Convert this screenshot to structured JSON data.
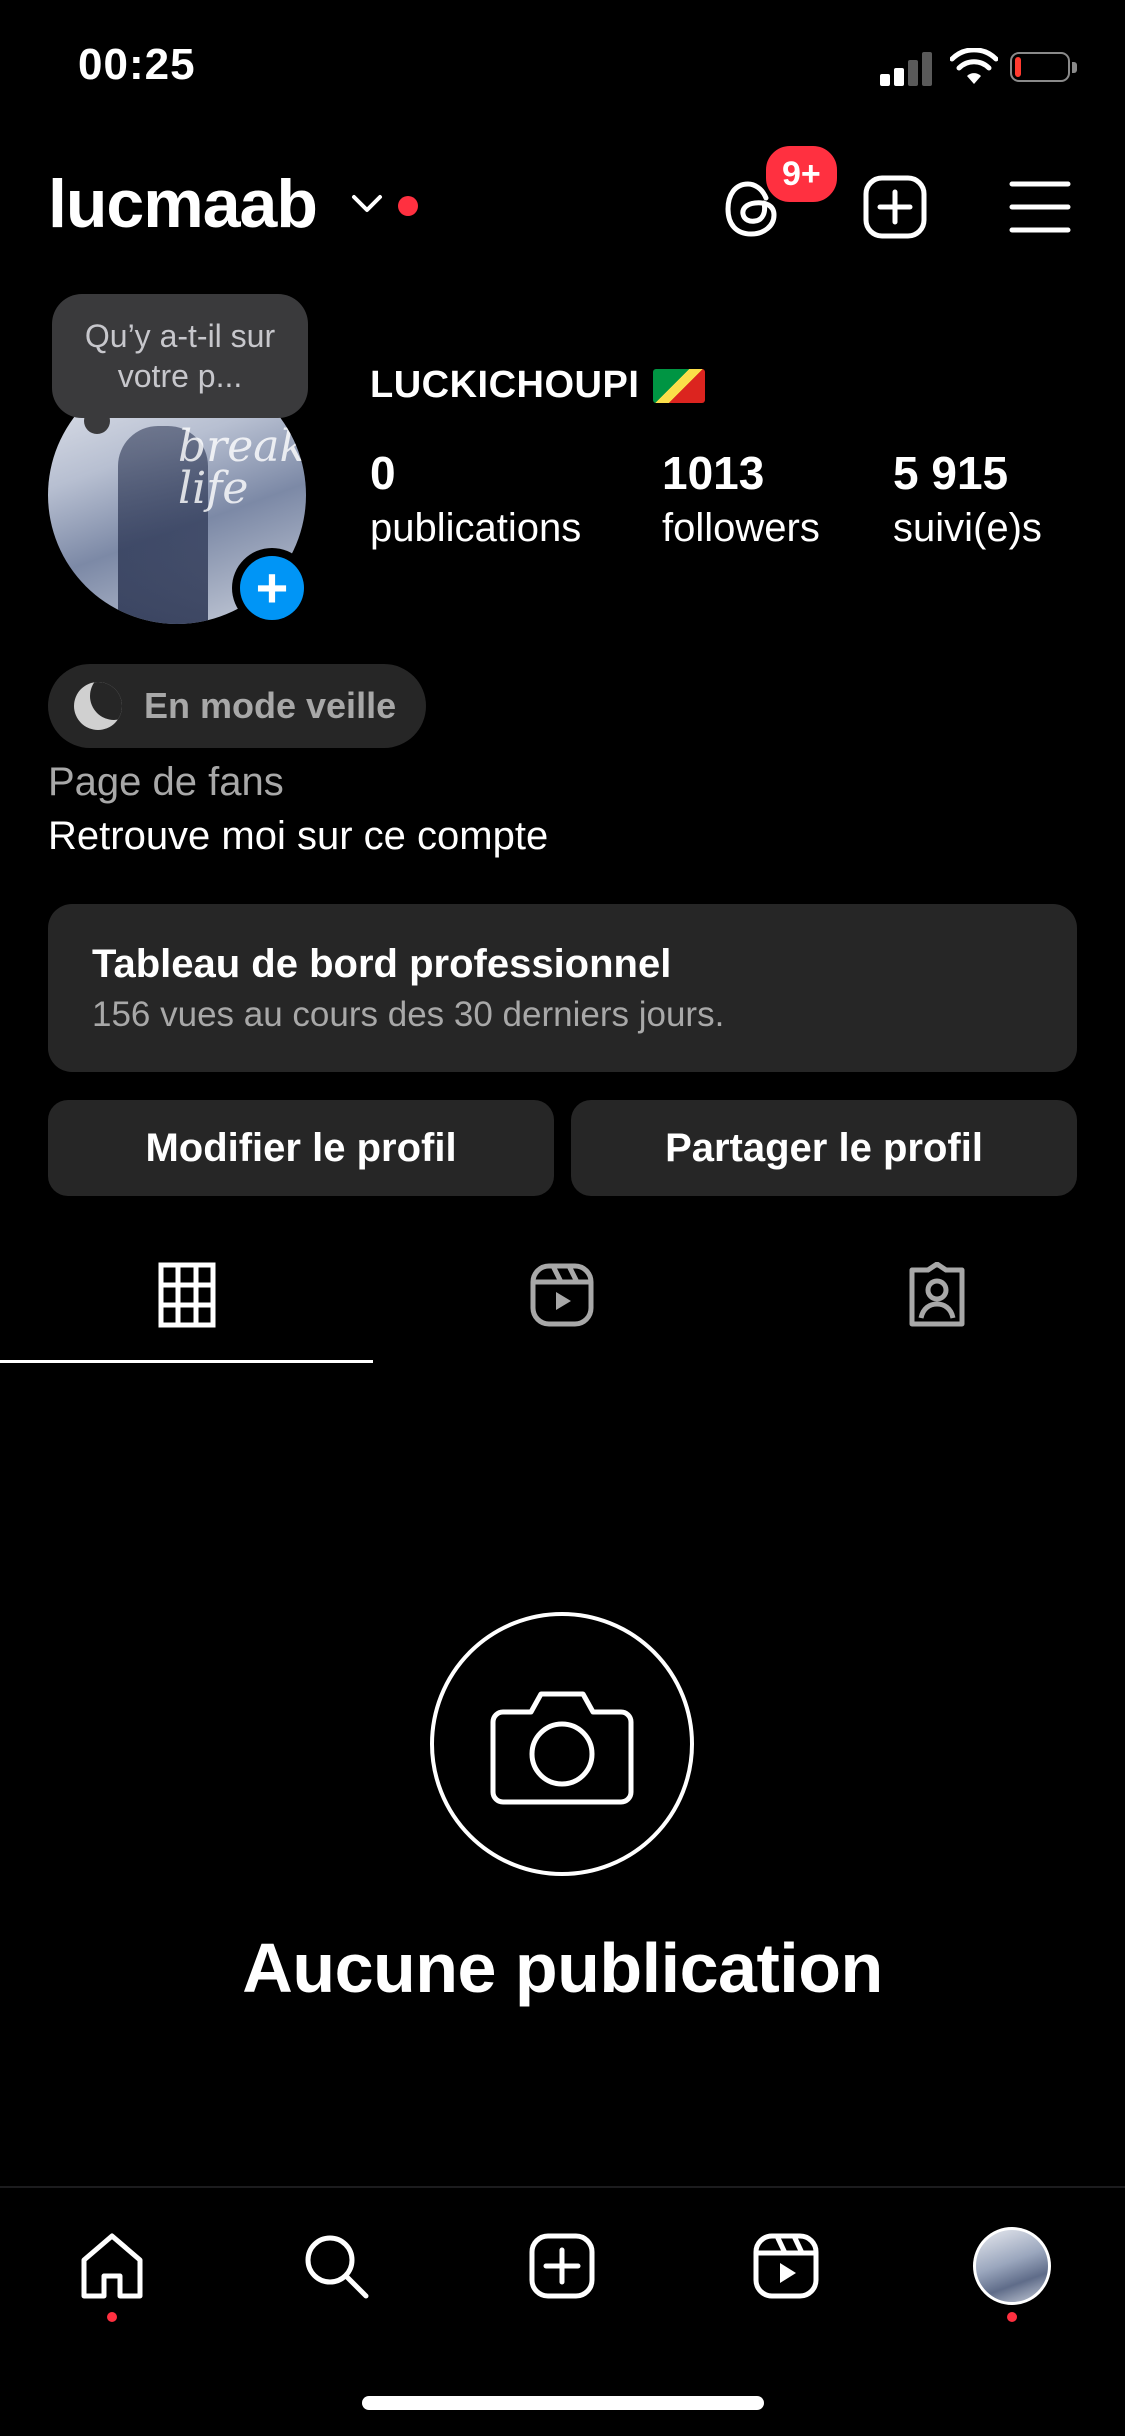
{
  "status_bar": {
    "time": "00:25"
  },
  "header": {
    "username": "lucmaab",
    "notification_badge": "9+",
    "icons": [
      "chevron-down-icon",
      "threads-icon",
      "new-post-icon",
      "menu-icon"
    ]
  },
  "note": {
    "text": "Qu’y a-t-il sur votre p..."
  },
  "avatar": {
    "overlay_text": "break life"
  },
  "profile": {
    "display_name": "LUCKICHOUPI",
    "stats": [
      {
        "value": "0",
        "label": "publications"
      },
      {
        "value": "1013",
        "label": "followers"
      },
      {
        "value": "5 915",
        "label": "suivi(e)s"
      }
    ],
    "status_chip": "En mode veille",
    "category": "Page de fans",
    "bio": "Retrouve moi sur ce compte"
  },
  "dashboard": {
    "title": "Tableau de bord professionnel",
    "subtitle": "156 vues au cours des 30 derniers jours."
  },
  "actions": {
    "edit": "Modifier le profil",
    "share": "Partager le profil"
  },
  "tabs": [
    "grid-icon",
    "reels-icon",
    "tagged-icon"
  ],
  "empty_state": {
    "title": "Aucune publication"
  },
  "bottom_nav": [
    "home-icon",
    "search-icon",
    "create-icon",
    "reels-icon",
    "profile-avatar"
  ],
  "colors": {
    "accent_red": "#ff3040",
    "accent_blue": "#0095f6",
    "surface": "#262626"
  }
}
